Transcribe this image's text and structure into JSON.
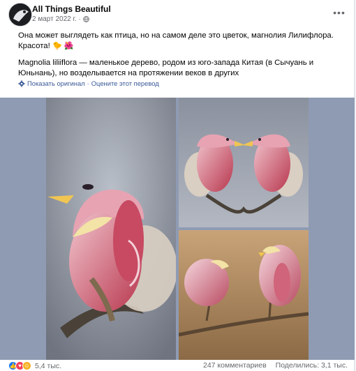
{
  "post": {
    "author": "All Things Beautiful",
    "date": "2 март 2022 г. ·",
    "more_icon": "ellipsis-icon",
    "text_lines": [
      "Она может выглядеть как птица, но на самом деле это цветок, магнолия Лилифлора. Красота!",
      "Magnolia liliiflora — маленькое дерево, родом из юго-запада Китая (в Сычуань и Юньнань), но возделывается на протяжении веков в других"
    ],
    "emojis": [
      "🐤",
      "🌺"
    ],
    "translate": {
      "show_original": "Показать оригинал",
      "rate": "Оцените этот перевод"
    }
  },
  "footer": {
    "reaction_count": "5,4 тыс.",
    "comments": "247 комментариев",
    "shares": "Поделились: 3,1 тыс."
  },
  "colors": {
    "link": "#385898",
    "muted": "#65676b",
    "like": "#1877f2",
    "love": "#f33e58",
    "care": "#f7b125"
  }
}
